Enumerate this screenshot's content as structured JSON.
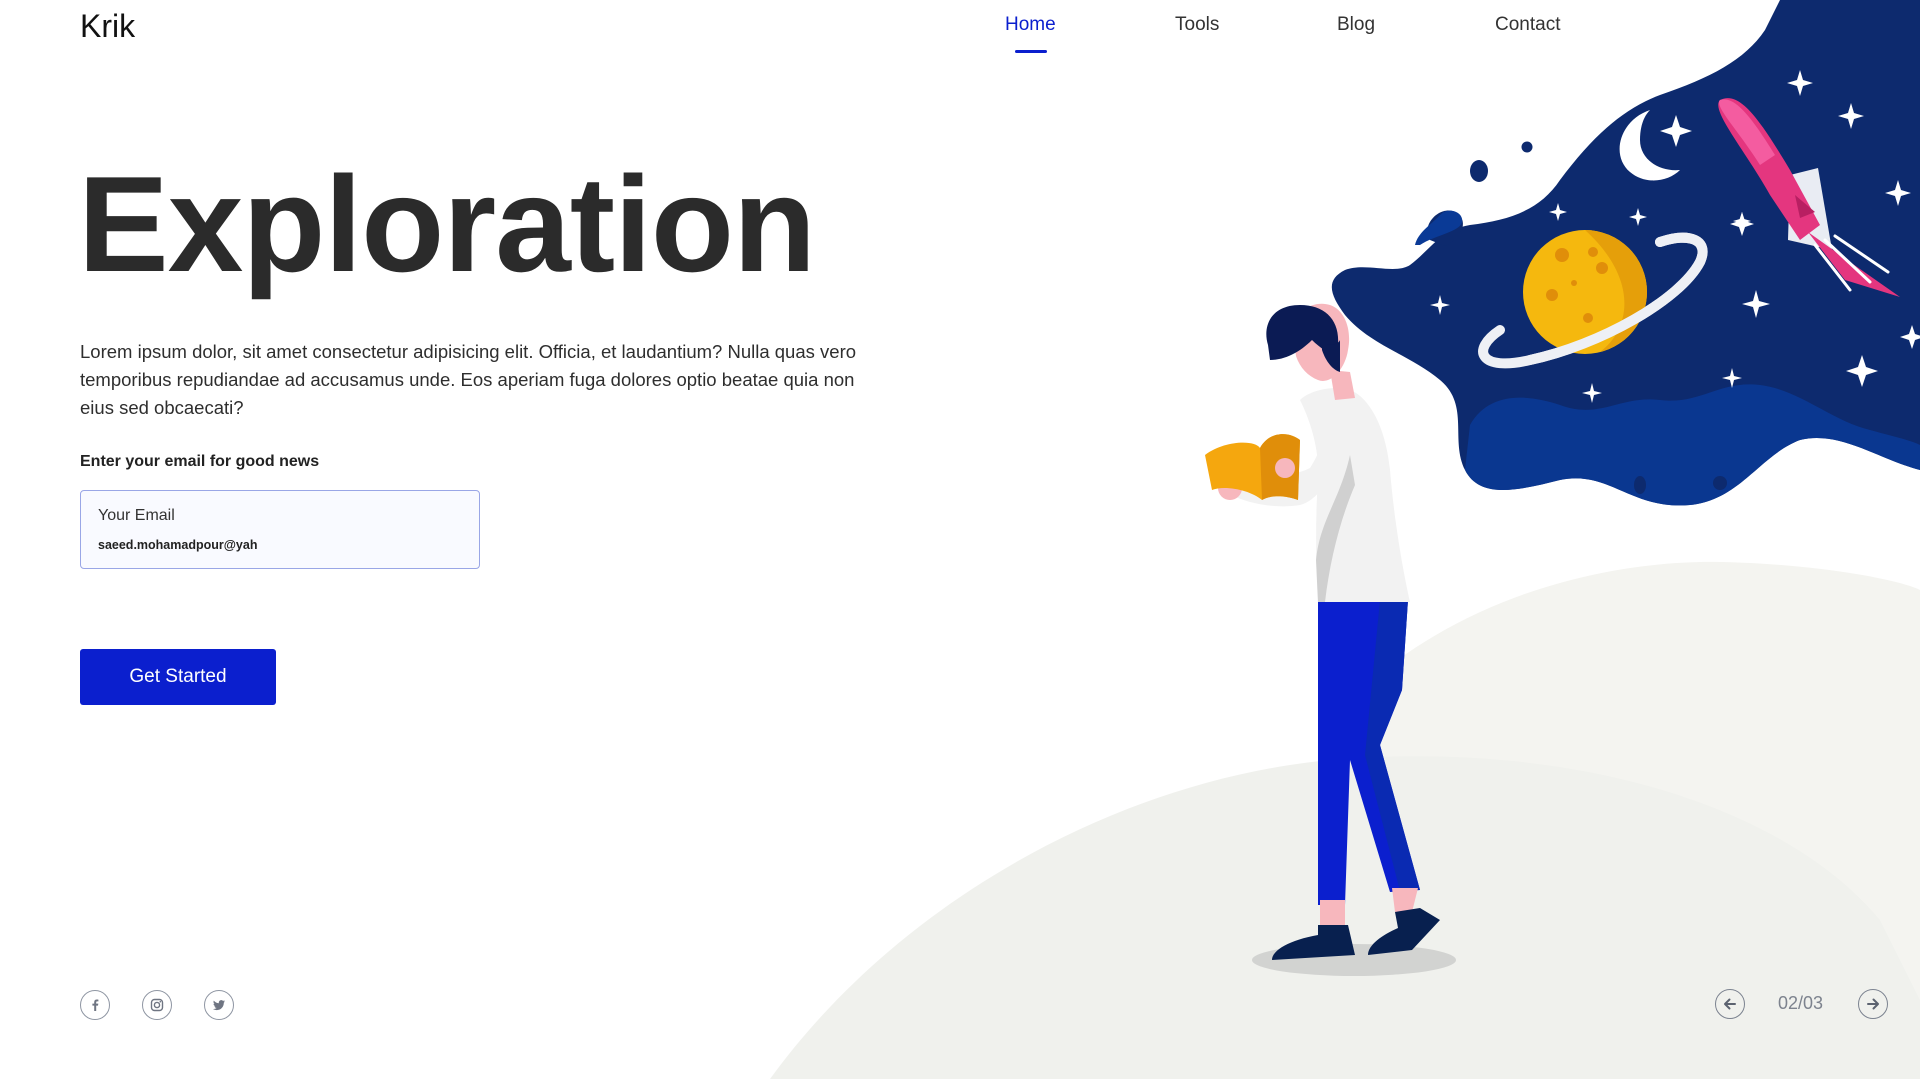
{
  "brand": {
    "logo": "Krik"
  },
  "nav": {
    "items": [
      {
        "label": "Home",
        "active": true
      },
      {
        "label": "Tools",
        "active": false
      },
      {
        "label": "Blog",
        "active": false
      },
      {
        "label": "Contact",
        "active": false
      }
    ]
  },
  "hero": {
    "title": "Exploration",
    "description": "Lorem ipsum dolor, sit amet consectetur adipisicing elit. Officia, et laudantium? Nulla quas vero temporibus repudiandae ad accusamus unde. Eos aperiam fuga dolores optio beatae quia non eius sed obcaecati?"
  },
  "signup": {
    "prompt": "Enter your email for good news",
    "field_label": "Your Email",
    "field_value": "saeed.mohamadpour@yah",
    "button_label": "Get Started"
  },
  "socials": [
    {
      "icon": "facebook-icon"
    },
    {
      "icon": "instagram-icon"
    },
    {
      "icon": "twitter-icon"
    }
  ],
  "pager": {
    "current": "02/03",
    "prev_icon": "arrow-left-icon",
    "next_icon": "arrow-right-icon"
  },
  "colors": {
    "accent": "#0b1fce",
    "space": "#0d2a6e",
    "planet": "#f5b80e",
    "rocket": "#e4367f",
    "hill": "#f0f1ed"
  }
}
